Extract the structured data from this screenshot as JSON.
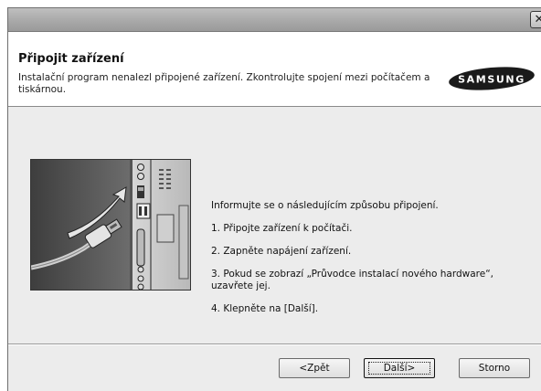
{
  "window": {
    "close_glyph": "✕"
  },
  "header": {
    "title": "Připojit zařízení",
    "description": "Instalační program nenalezl připojené zařízení. Zkontrolujte spojení mezi počítačem a tiskárnou.",
    "logo_text": "SAMSUNG"
  },
  "illustration": {
    "icon": "usb-cable-plug-into-computer"
  },
  "instructions": {
    "intro": "Informujte se o následujícím způsobu připojení.",
    "steps": [
      "1. Připojte zařízení k počítači.",
      "2. Zapněte napájení zařízení.",
      "3. Pokud se zobrazí „Průvodce instalací nového hardware“, uzavřete jej.",
      "4. Klepněte na [Další]."
    ]
  },
  "buttons": {
    "back": "<Zpět",
    "next": "Další>",
    "cancel": "Storno"
  },
  "colors": {
    "header_bg": "#ffffff",
    "body_bg": "#ececec",
    "titlebar": "#a9a9a9",
    "logo_bg": "#1a1a1a"
  }
}
